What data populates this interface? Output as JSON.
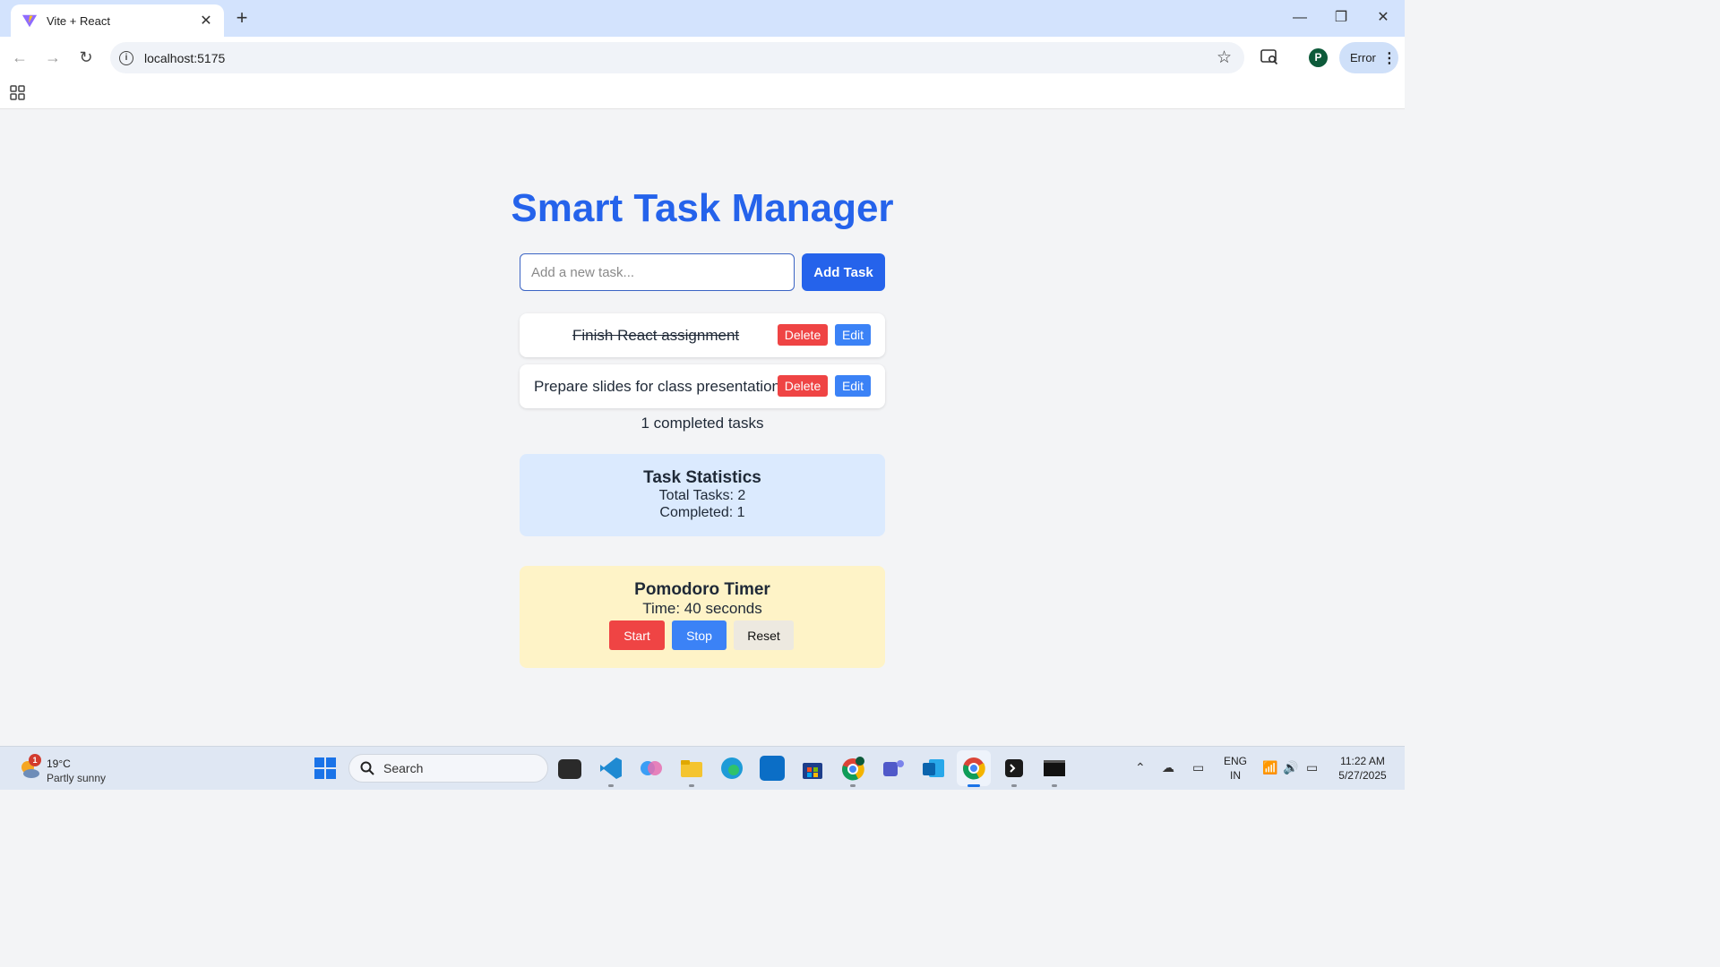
{
  "browser": {
    "tab_title": "Vite + React",
    "url": "localhost:5175",
    "profile_initial": "P",
    "error_label": "Error",
    "icons": [
      "vite-logo",
      "close-icon",
      "plus-icon",
      "back-icon",
      "forward-icon",
      "reload-icon",
      "info-icon",
      "star-icon",
      "search-tabs-icon",
      "kebab-icon",
      "apps-grid-icon",
      "minimize-icon",
      "restore-icon",
      "window-close-icon"
    ]
  },
  "app": {
    "title": "Smart Task Manager",
    "input": {
      "placeholder": "Add a new task...",
      "value": ""
    },
    "add_button": "Add Task",
    "tasks": [
      {
        "text": "Finish React assignment",
        "completed": true,
        "delete_label": "Delete",
        "edit_label": "Edit"
      },
      {
        "text": "Prepare slides for class presentation",
        "completed": false,
        "delete_label": "Delete",
        "edit_label": "Edit"
      }
    ],
    "completed_summary": "1 completed tasks",
    "stats": {
      "heading": "Task Statistics",
      "total": "Total Tasks: 2",
      "completed": "Completed: 1"
    },
    "pomodoro": {
      "heading": "Pomodoro Timer",
      "time": "Time: 40 seconds",
      "start_label": "Start",
      "stop_label": "Stop",
      "reset_label": "Reset"
    },
    "colors": {
      "title": "#2563eb",
      "delete": "#ef4444",
      "edit": "#3b82f6",
      "stats_bg": "#dbeafe",
      "pomodoro_bg": "#fef3c7"
    }
  },
  "taskbar": {
    "weather_temp": "19°C",
    "weather_desc": "Partly sunny",
    "weather_badge": "1",
    "search_label": "Search",
    "lang_top": "ENG",
    "lang_bottom": "IN",
    "time": "11:22 AM",
    "date": "5/27/2025"
  }
}
